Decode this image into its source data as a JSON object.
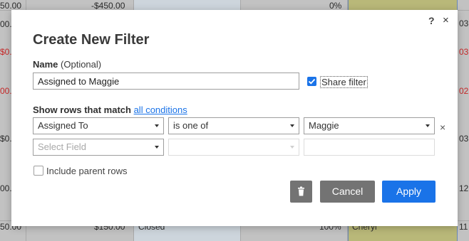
{
  "background": {
    "left_col": [
      "50.00",
      "00.",
      "$0.",
      "00.",
      "$0.",
      "00.",
      "50.00"
    ],
    "amounts": [
      "-$450.00",
      "$150.00"
    ],
    "status": "Closed",
    "percents": [
      "0%",
      "100%"
    ],
    "assignee": "Cheryl",
    "right_col": [
      "03",
      "03",
      "02",
      "03",
      "12",
      "11"
    ]
  },
  "dialog": {
    "title": "Create New Filter",
    "help_label": "?",
    "close_label": "×",
    "name_label": "Name",
    "name_optional": " (Optional)",
    "name_value": "Assigned to Maggie",
    "share_label": "Share filter",
    "share_checked": true,
    "match_prefix": "Show rows that match ",
    "match_link": "all conditions",
    "conditions": [
      {
        "field": "Assigned To",
        "operator": "is one of",
        "value": "Maggie",
        "remove_label": "×"
      },
      {
        "field": "Select Field",
        "operator": "",
        "value": ""
      }
    ],
    "include_parent_label": "Include parent rows",
    "include_parent_checked": false,
    "buttons": {
      "cancel": "Cancel",
      "apply": "Apply"
    }
  },
  "colors": {
    "accent": "#1a73e8",
    "button_gray": "#737373",
    "negative": "#c62828"
  }
}
